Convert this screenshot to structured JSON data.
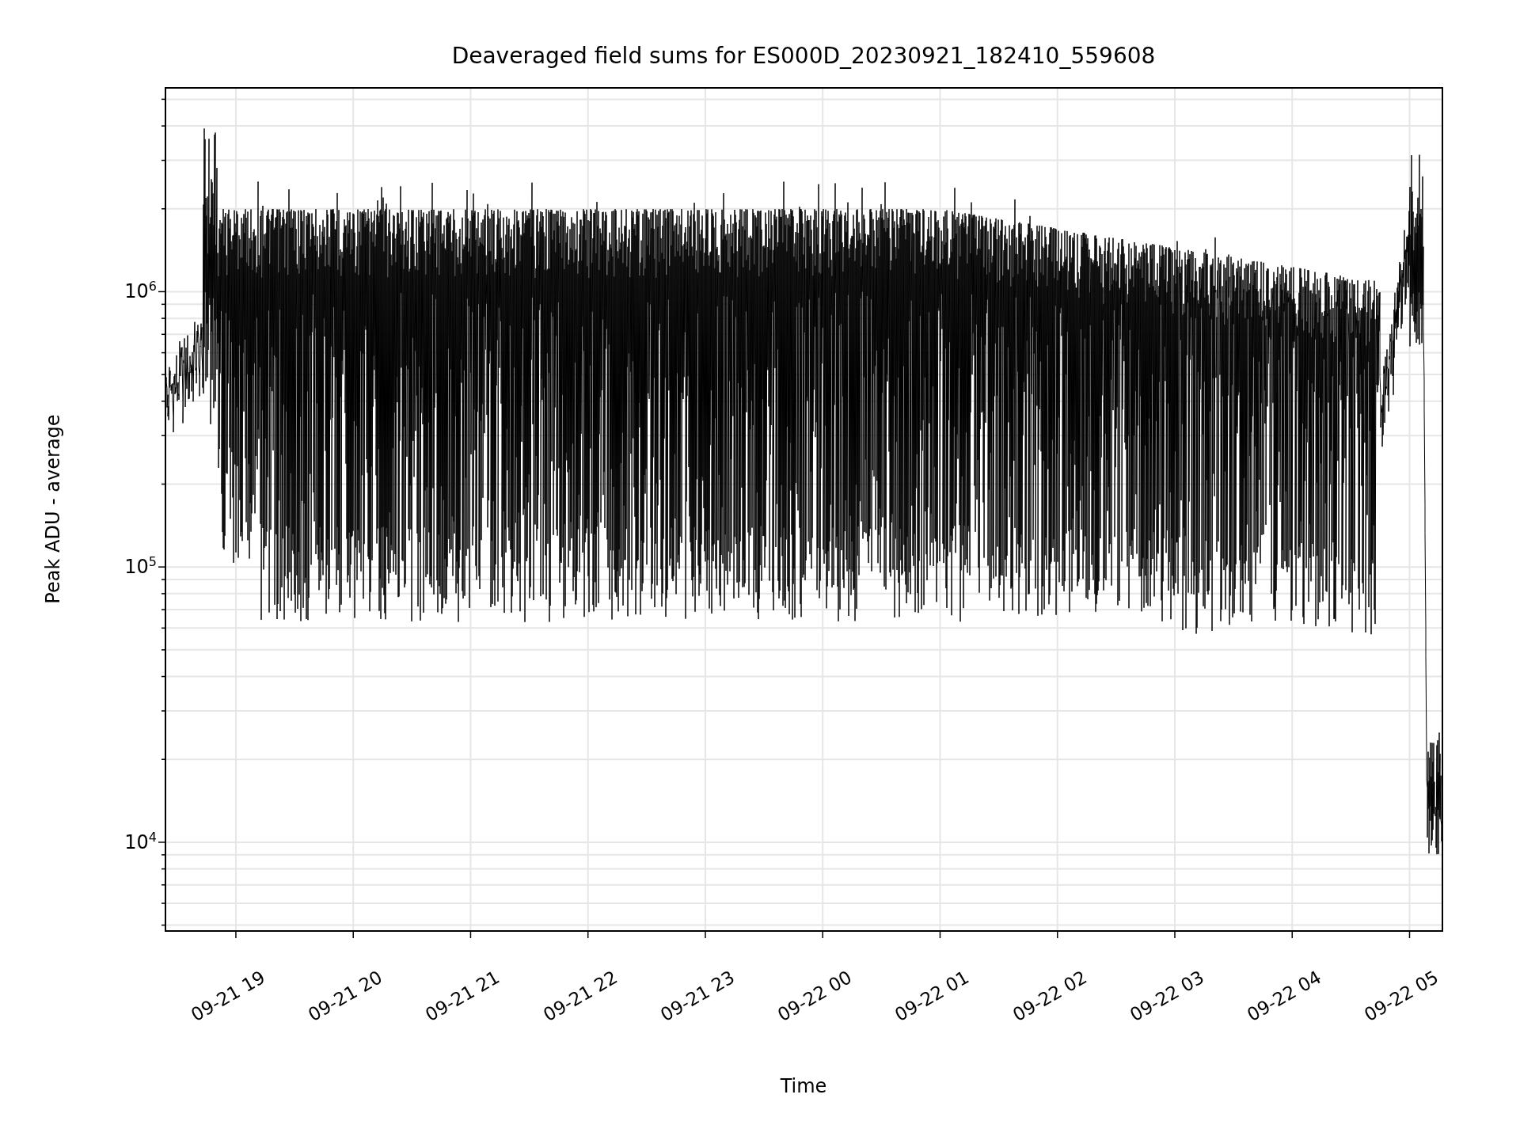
{
  "figure": {
    "title": "Deaveraged field sums for ES000D_20230921_182410_559608",
    "ylabel": "Peak ADU - average",
    "xlabel": "Time",
    "yticks": [
      "10$^{6}$",
      "10$^{5}$",
      "10$^{4}$"
    ],
    "xticks": [
      "09-21 19",
      "09-21 20",
      "09-21 21",
      "09-21 22",
      "09-21 23",
      "09-22 00",
      "09-22 01",
      "09-22 02",
      "09-22 03",
      "09-22 04",
      "09-22 05"
    ]
  }
}
